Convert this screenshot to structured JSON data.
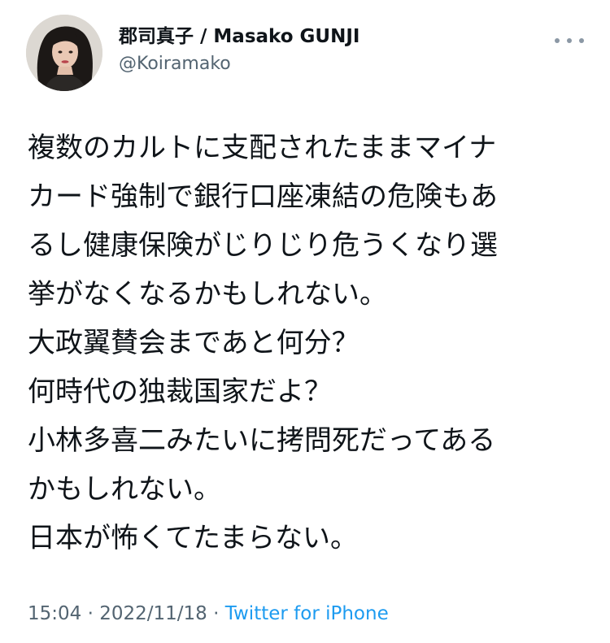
{
  "tweet": {
    "author": {
      "display_name": "郡司真子 / Masako GUNJI",
      "handle": "@Koiramako",
      "avatar": "profile-photo"
    },
    "more_icon": "more-horizontal-icon",
    "text_lines": [
      "複数のカルトに支配されたままマイナ",
      "カード強制で銀行口座凍結の危険もあ",
      "るし健康保険がじりじり危うくなり選",
      "挙がなくなるかもしれない。",
      "大政翼賛会まであと何分？",
      "何時代の独裁国家だよ？",
      "小林多喜二みたいに拷問死だってある",
      "かもしれない。",
      "日本が怖くてたまらない。"
    ],
    "time": "15:04",
    "separator": " · ",
    "date": "2022/11/18",
    "source": "Twitter for iPhone"
  },
  "colors": {
    "text": "#0f1419",
    "secondary": "#536471",
    "link": "#1d9bf0"
  }
}
